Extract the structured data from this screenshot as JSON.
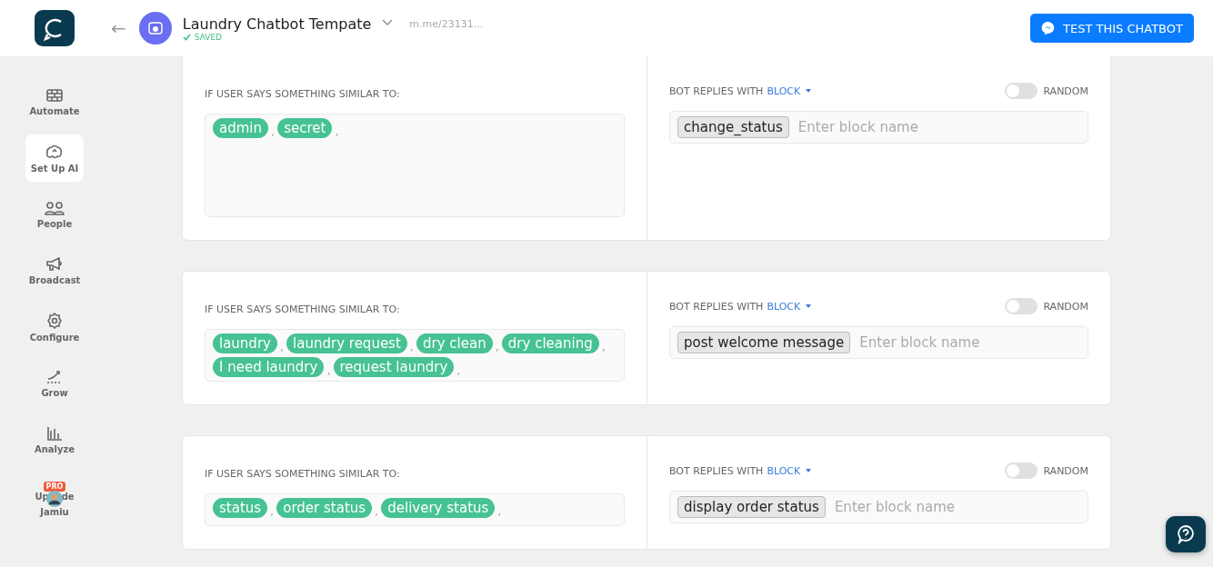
{
  "header": {
    "back": "←",
    "title": "Laundry Chatbot Tempate",
    "status": "SAVED",
    "link": "m.me/23131...",
    "test_button": "TEST THIS CHATBOT"
  },
  "sidebar": {
    "items": [
      {
        "label": "Automate",
        "selected": false
      },
      {
        "label": "Set Up AI",
        "selected": true
      },
      {
        "label": "People",
        "selected": false
      },
      {
        "label": "Broadcast",
        "selected": false
      },
      {
        "label": "Configure",
        "selected": false
      },
      {
        "label": "Grow",
        "selected": false
      },
      {
        "label": "Analyze",
        "selected": false
      }
    ],
    "upgrade": {
      "badge": "PRO",
      "label_start": "Up",
      "label_end": "de"
    },
    "user": "Jamiu"
  },
  "rules": [
    {
      "user_label": "IF USER SAYS SOMETHING SIMILAR TO:",
      "phrases": [
        "admin",
        "secret"
      ],
      "reply_label": "BOT REPLIES WITH",
      "reply_type": "BLOCK",
      "random": false,
      "random_label": "RANDOM",
      "blocks": [
        "change_status"
      ],
      "placeholder": "Enter block name",
      "separator": ",",
      "cut_top": true
    },
    {
      "user_label": "IF USER SAYS SOMETHING SIMILAR TO:",
      "phrases": [
        "laundry",
        "laundry request",
        "dry clean",
        "dry cleaning",
        "I need laundry",
        "request laundry"
      ],
      "reply_label": "BOT REPLIES WITH",
      "reply_type": "BLOCK",
      "random": false,
      "random_label": "RANDOM",
      "blocks": [
        "post welcome message"
      ],
      "placeholder": "Enter block name",
      "separator": ",",
      "cut_top": false
    },
    {
      "user_label": "IF USER SAYS SOMETHING SIMILAR TO:",
      "phrases": [
        "status",
        "order status",
        "delivery status"
      ],
      "reply_label": "BOT REPLIES WITH",
      "reply_type": "BLOCK",
      "random": false,
      "random_label": "RANDOM",
      "blocks": [
        "display order status"
      ],
      "placeholder": "Enter block name",
      "separator": ",",
      "cut_top": false
    }
  ]
}
